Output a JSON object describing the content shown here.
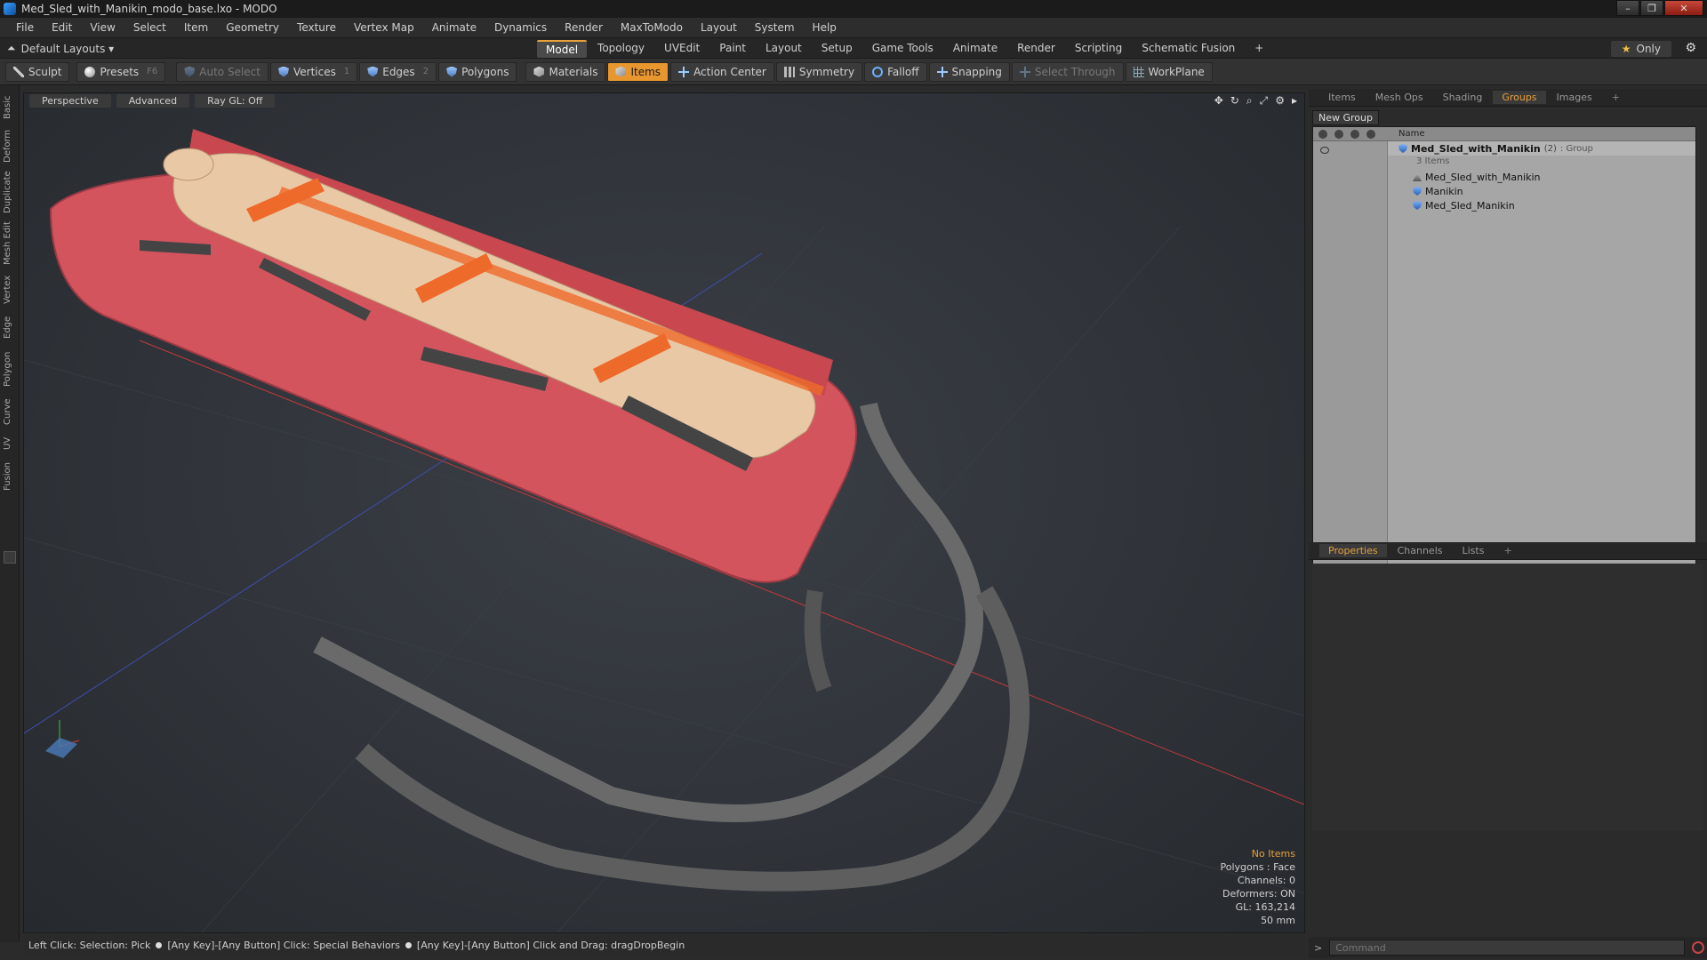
{
  "window": {
    "title": "Med_Sled_with_Manikin_modo_base.lxo - MODO",
    "buttons": [
      "–",
      "❐",
      "✕"
    ]
  },
  "menu": [
    "File",
    "Edit",
    "View",
    "Select",
    "Item",
    "Geometry",
    "Texture",
    "Vertex Map",
    "Animate",
    "Dynamics",
    "Render",
    "MaxToModo",
    "Layout",
    "System",
    "Help"
  ],
  "layout": {
    "dropdown": "Default Layouts ▾",
    "tabs": [
      "Model",
      "Topology",
      "UVEdit",
      "Paint",
      "Layout",
      "Setup",
      "Game Tools",
      "Animate",
      "Render",
      "Scripting",
      "Schematic Fusion",
      "+"
    ],
    "active_tab": "Model",
    "only_label": "Only"
  },
  "toolbar": {
    "sculpt": "Sculpt",
    "presets": "Presets",
    "presets_key": "F6",
    "auto_select": "Auto Select",
    "vertices": "Vertices",
    "vertices_key": "1",
    "edges": "Edges",
    "edges_key": "2",
    "polygons": "Polygons",
    "materials": "Materials",
    "items": "Items",
    "action_center": "Action Center",
    "symmetry": "Symmetry",
    "falloff": "Falloff",
    "snapping": "Snapping",
    "select_through": "Select Through",
    "workplane": "WorkPlane"
  },
  "left_tabs": [
    "Basic",
    "Deform",
    "Duplicate",
    "Mesh Edit",
    "Vertex",
    "Edge",
    "Polygon",
    "Curve",
    "UV",
    "Fusion"
  ],
  "viewport": {
    "view": "Perspective",
    "shading": "Advanced",
    "raygl": "Ray GL: Off",
    "info": {
      "no_items": "No Items",
      "polygons": "Polygons : Face",
      "channels": "Channels: 0",
      "deformers": "Deformers: ON",
      "gl": "GL: 163,214",
      "scale": "50 mm"
    }
  },
  "status": {
    "part1": "Left Click: Selection: Pick",
    "part2": "[Any Key]-[Any Button] Click: Special Behaviors",
    "part3": "[Any Key]-[Any Button] Click and Drag: dragDropBegin"
  },
  "panel_top": {
    "tabs": [
      "Items",
      "Mesh Ops",
      "Shading",
      "Groups",
      "Images",
      "+"
    ],
    "active": "Groups",
    "new_group": "New Group",
    "column_name": "Name",
    "rows": [
      {
        "label": "Med_Sled_with_Manikin",
        "count": "(2)",
        "kind": ": Group"
      },
      {
        "label": "3 Items"
      },
      {
        "label": "Med_Sled_with_Manikin"
      },
      {
        "label": "Manikin"
      },
      {
        "label": "Med_Sled_Manikin"
      }
    ]
  },
  "panel_bottom": {
    "tabs": [
      "Properties",
      "Channels",
      "Lists",
      "+"
    ],
    "active": "Properties"
  },
  "command": {
    "placeholder": "Command",
    "prompt": ">"
  },
  "colors": {
    "accent": "#e8962e",
    "sled": "#d4545e",
    "strap": "#ee6a2a",
    "skin": "#e9c8a6"
  }
}
